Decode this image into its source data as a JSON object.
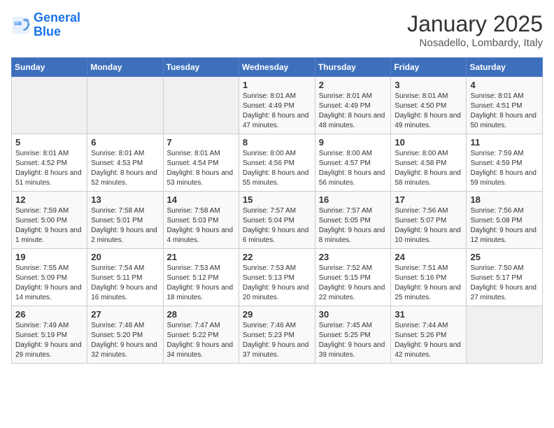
{
  "logo": {
    "text_general": "General",
    "text_blue": "Blue"
  },
  "header": {
    "title": "January 2025",
    "subtitle": "Nosadello, Lombardy, Italy"
  },
  "weekdays": [
    "Sunday",
    "Monday",
    "Tuesday",
    "Wednesday",
    "Thursday",
    "Friday",
    "Saturday"
  ],
  "weeks": [
    [
      {
        "day": "",
        "sunrise": "",
        "sunset": "",
        "daylight": "",
        "empty": true
      },
      {
        "day": "",
        "sunrise": "",
        "sunset": "",
        "daylight": "",
        "empty": true
      },
      {
        "day": "",
        "sunrise": "",
        "sunset": "",
        "daylight": "",
        "empty": true
      },
      {
        "day": "1",
        "sunrise": "Sunrise: 8:01 AM",
        "sunset": "Sunset: 4:49 PM",
        "daylight": "Daylight: 8 hours and 47 minutes."
      },
      {
        "day": "2",
        "sunrise": "Sunrise: 8:01 AM",
        "sunset": "Sunset: 4:49 PM",
        "daylight": "Daylight: 8 hours and 48 minutes."
      },
      {
        "day": "3",
        "sunrise": "Sunrise: 8:01 AM",
        "sunset": "Sunset: 4:50 PM",
        "daylight": "Daylight: 8 hours and 49 minutes."
      },
      {
        "day": "4",
        "sunrise": "Sunrise: 8:01 AM",
        "sunset": "Sunset: 4:51 PM",
        "daylight": "Daylight: 8 hours and 50 minutes."
      }
    ],
    [
      {
        "day": "5",
        "sunrise": "Sunrise: 8:01 AM",
        "sunset": "Sunset: 4:52 PM",
        "daylight": "Daylight: 8 hours and 51 minutes."
      },
      {
        "day": "6",
        "sunrise": "Sunrise: 8:01 AM",
        "sunset": "Sunset: 4:53 PM",
        "daylight": "Daylight: 8 hours and 52 minutes."
      },
      {
        "day": "7",
        "sunrise": "Sunrise: 8:01 AM",
        "sunset": "Sunset: 4:54 PM",
        "daylight": "Daylight: 8 hours and 53 minutes."
      },
      {
        "day": "8",
        "sunrise": "Sunrise: 8:00 AM",
        "sunset": "Sunset: 4:56 PM",
        "daylight": "Daylight: 8 hours and 55 minutes."
      },
      {
        "day": "9",
        "sunrise": "Sunrise: 8:00 AM",
        "sunset": "Sunset: 4:57 PM",
        "daylight": "Daylight: 8 hours and 56 minutes."
      },
      {
        "day": "10",
        "sunrise": "Sunrise: 8:00 AM",
        "sunset": "Sunset: 4:58 PM",
        "daylight": "Daylight: 8 hours and 58 minutes."
      },
      {
        "day": "11",
        "sunrise": "Sunrise: 7:59 AM",
        "sunset": "Sunset: 4:59 PM",
        "daylight": "Daylight: 8 hours and 59 minutes."
      }
    ],
    [
      {
        "day": "12",
        "sunrise": "Sunrise: 7:59 AM",
        "sunset": "Sunset: 5:00 PM",
        "daylight": "Daylight: 9 hours and 1 minute."
      },
      {
        "day": "13",
        "sunrise": "Sunrise: 7:58 AM",
        "sunset": "Sunset: 5:01 PM",
        "daylight": "Daylight: 9 hours and 2 minutes."
      },
      {
        "day": "14",
        "sunrise": "Sunrise: 7:58 AM",
        "sunset": "Sunset: 5:03 PM",
        "daylight": "Daylight: 9 hours and 4 minutes."
      },
      {
        "day": "15",
        "sunrise": "Sunrise: 7:57 AM",
        "sunset": "Sunset: 5:04 PM",
        "daylight": "Daylight: 9 hours and 6 minutes."
      },
      {
        "day": "16",
        "sunrise": "Sunrise: 7:57 AM",
        "sunset": "Sunset: 5:05 PM",
        "daylight": "Daylight: 9 hours and 8 minutes."
      },
      {
        "day": "17",
        "sunrise": "Sunrise: 7:56 AM",
        "sunset": "Sunset: 5:07 PM",
        "daylight": "Daylight: 9 hours and 10 minutes."
      },
      {
        "day": "18",
        "sunrise": "Sunrise: 7:56 AM",
        "sunset": "Sunset: 5:08 PM",
        "daylight": "Daylight: 9 hours and 12 minutes."
      }
    ],
    [
      {
        "day": "19",
        "sunrise": "Sunrise: 7:55 AM",
        "sunset": "Sunset: 5:09 PM",
        "daylight": "Daylight: 9 hours and 14 minutes."
      },
      {
        "day": "20",
        "sunrise": "Sunrise: 7:54 AM",
        "sunset": "Sunset: 5:11 PM",
        "daylight": "Daylight: 9 hours and 16 minutes."
      },
      {
        "day": "21",
        "sunrise": "Sunrise: 7:53 AM",
        "sunset": "Sunset: 5:12 PM",
        "daylight": "Daylight: 9 hours and 18 minutes."
      },
      {
        "day": "22",
        "sunrise": "Sunrise: 7:53 AM",
        "sunset": "Sunset: 5:13 PM",
        "daylight": "Daylight: 9 hours and 20 minutes."
      },
      {
        "day": "23",
        "sunrise": "Sunrise: 7:52 AM",
        "sunset": "Sunset: 5:15 PM",
        "daylight": "Daylight: 9 hours and 22 minutes."
      },
      {
        "day": "24",
        "sunrise": "Sunrise: 7:51 AM",
        "sunset": "Sunset: 5:16 PM",
        "daylight": "Daylight: 9 hours and 25 minutes."
      },
      {
        "day": "25",
        "sunrise": "Sunrise: 7:50 AM",
        "sunset": "Sunset: 5:17 PM",
        "daylight": "Daylight: 9 hours and 27 minutes."
      }
    ],
    [
      {
        "day": "26",
        "sunrise": "Sunrise: 7:49 AM",
        "sunset": "Sunset: 5:19 PM",
        "daylight": "Daylight: 9 hours and 29 minutes."
      },
      {
        "day": "27",
        "sunrise": "Sunrise: 7:48 AM",
        "sunset": "Sunset: 5:20 PM",
        "daylight": "Daylight: 9 hours and 32 minutes."
      },
      {
        "day": "28",
        "sunrise": "Sunrise: 7:47 AM",
        "sunset": "Sunset: 5:22 PM",
        "daylight": "Daylight: 9 hours and 34 minutes."
      },
      {
        "day": "29",
        "sunrise": "Sunrise: 7:46 AM",
        "sunset": "Sunset: 5:23 PM",
        "daylight": "Daylight: 9 hours and 37 minutes."
      },
      {
        "day": "30",
        "sunrise": "Sunrise: 7:45 AM",
        "sunset": "Sunset: 5:25 PM",
        "daylight": "Daylight: 9 hours and 39 minutes."
      },
      {
        "day": "31",
        "sunrise": "Sunrise: 7:44 AM",
        "sunset": "Sunset: 5:26 PM",
        "daylight": "Daylight: 9 hours and 42 minutes."
      },
      {
        "day": "",
        "sunrise": "",
        "sunset": "",
        "daylight": "",
        "empty": true
      }
    ]
  ]
}
